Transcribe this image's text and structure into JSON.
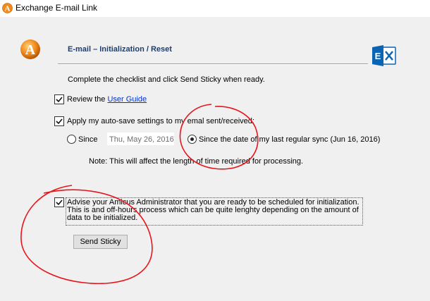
{
  "window": {
    "title": "Exchange E-mail Link"
  },
  "header": {
    "title": "E-mail – Initialization / Reset"
  },
  "instructions": "Complete the checklist and click Send Sticky when ready.",
  "checklist": {
    "review": {
      "prefix": "Review the ",
      "link_text": "User Guide",
      "checked": true
    },
    "autosave": {
      "label": "Apply my auto-save settings to my emal sent/received:",
      "checked": true
    },
    "since_radio": {
      "label": "Since",
      "selected": false
    },
    "since_date": {
      "value": "Thu, May 26, 2016"
    },
    "last_sync_radio": {
      "label": "Since the date of my last regular sync (Jun 16, 2016)",
      "selected": true
    },
    "note": "Note: This will affect the length of time required for processing.",
    "advise": {
      "text": "Advise your Amicus Administrator that you are ready to be scheduled for initialization. This is and off-hours process which can be quite lenghty depending on the amount of data to be initialized.",
      "checked": true
    }
  },
  "buttons": {
    "send_sticky": "Send Sticky"
  },
  "colors": {
    "annotation": "#e8141c",
    "header_text": "#1e3f6e",
    "link": "#0033cc",
    "exchange_blue": "#0a64b4",
    "amicus_orange": "#f08a1c"
  },
  "icons": {
    "app": "amicus-a-icon",
    "exchange": "exchange-logo-icon",
    "check": "checkmark-icon"
  }
}
